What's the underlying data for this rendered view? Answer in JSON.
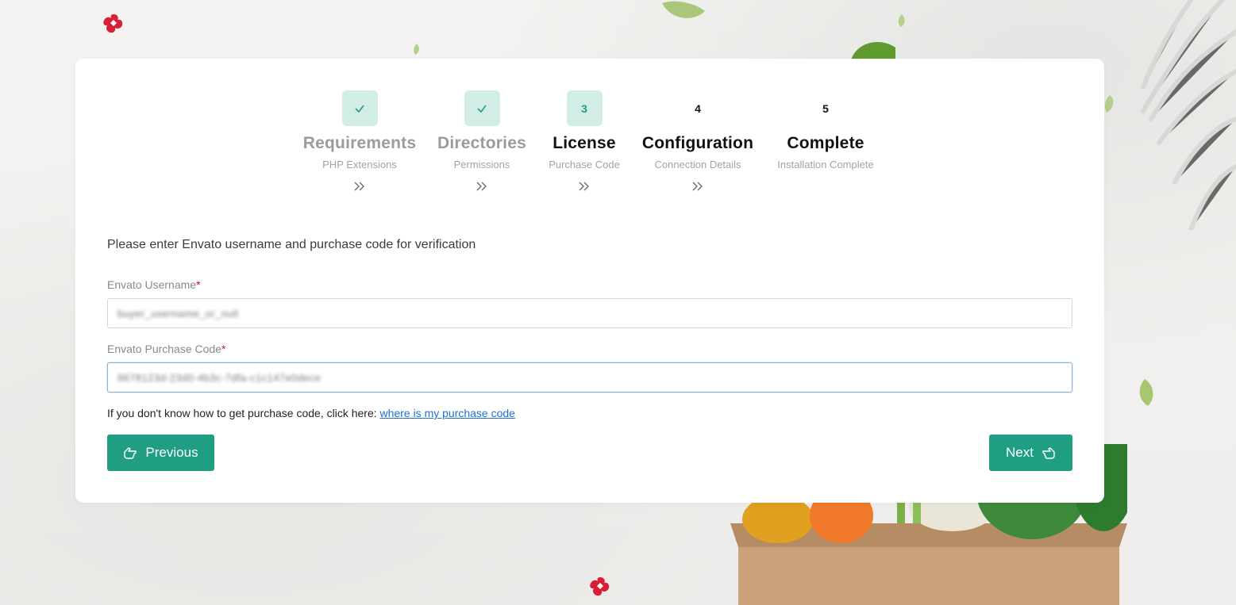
{
  "steps": [
    {
      "badge": "✓",
      "title": "Requirements",
      "subtitle": "PHP Extensions",
      "state": "done"
    },
    {
      "badge": "✓",
      "title": "Directories",
      "subtitle": "Permissions",
      "state": "done"
    },
    {
      "badge": "3",
      "title": "License",
      "subtitle": "Purchase Code",
      "state": "active"
    },
    {
      "badge": "4",
      "title": "Configuration",
      "subtitle": "Connection Details",
      "state": "pending"
    },
    {
      "badge": "5",
      "title": "Complete",
      "subtitle": "Installation Complete",
      "state": "pending"
    }
  ],
  "form": {
    "intro": "Please enter Envato username and purchase code for verification",
    "username_label": "Envato Username",
    "username_value": "buyer_username_or_null",
    "purchase_code_label": "Envato Purchase Code",
    "purchase_code_value": "8678123d-23d0-4b3c-7dfa-c1c147e0dece",
    "required_mark": "*",
    "hint_text": "If you don't know how to get purchase code, click here: ",
    "hint_link": "where is my purchase code"
  },
  "buttons": {
    "previous": "Previous",
    "next": "Next"
  },
  "colors": {
    "accent": "#1f9e84",
    "badge_bg": "#d2ece6",
    "required": "#c0143c",
    "link": "#1f6fd1"
  },
  "icons": {
    "step_done": "check-icon",
    "step_separator": "double-chevron-right-icon",
    "previous": "hand-pointing-left-icon",
    "next": "hand-pointing-right-icon",
    "brand": "brand-logo-icon"
  }
}
